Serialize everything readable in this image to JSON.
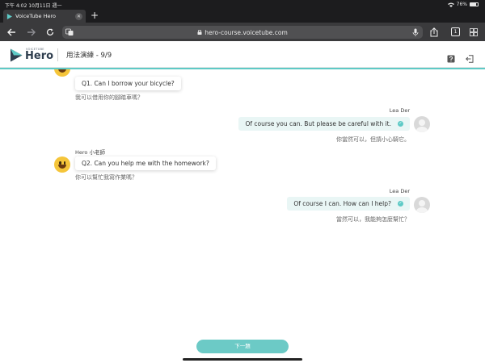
{
  "status_bar": {
    "time_date": "下午 4:02 10月11日 週一",
    "battery": "76%",
    "battery_level": 0.76
  },
  "browser": {
    "tab_title": "VoiceTube Hero",
    "url": "hero-course.voicetube.com",
    "tab_count": "1"
  },
  "header": {
    "brand_sub": "VOICETUBE",
    "brand_name": "Hero",
    "page_title": "用法演練 - 9/9"
  },
  "chat": [
    {
      "speaker": "",
      "question": "Q1. Can I borrow your bicycle?",
      "translation": "我可以借用你的腳踏車嗎？"
    },
    {
      "speaker": "Lea Der",
      "answer": "Of course you can. But please be careful with it.",
      "translation": "你當然可以，但請小心騎它。"
    },
    {
      "speaker": "Hero 小老師",
      "question": "Q2. Can you help me with the homework?",
      "translation": "你可以幫忙我寫作業嗎？"
    },
    {
      "speaker": "Lea Der",
      "answer": "Of course I can. How can I help?",
      "translation": "當然可以，我能夠怎麼幫忙？"
    }
  ],
  "footer": {
    "next_label": "下一題"
  },
  "colors": {
    "accent": "#5ecac6",
    "answer_bg": "#e9f6f5",
    "brand": "#2f3e4e"
  }
}
